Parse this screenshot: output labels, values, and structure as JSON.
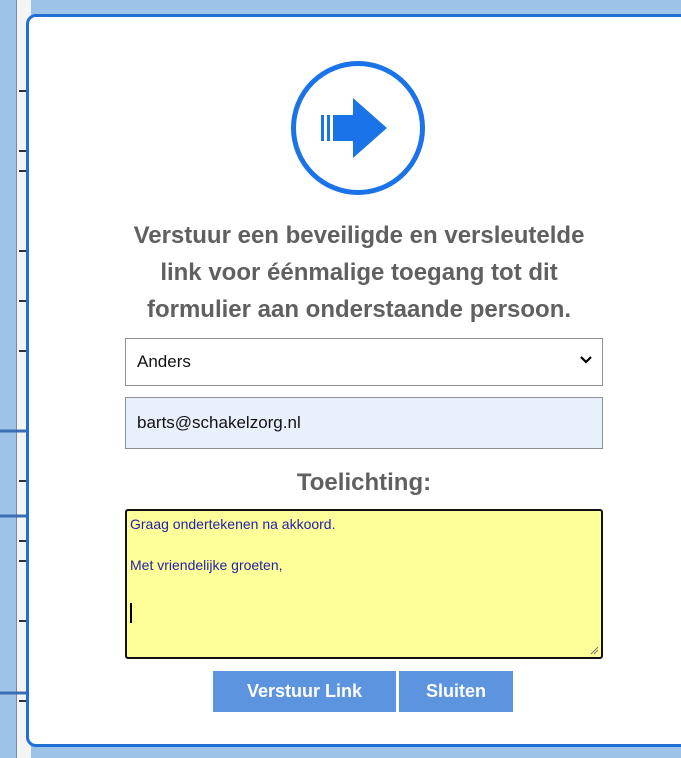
{
  "dialog": {
    "icon": "arrow-right-circle-icon",
    "title_lines": [
      "Verstuur een beveiligde en versleutelde",
      "link voor éénmalige toegang tot dit",
      "formulier aan onderstaande persoon."
    ],
    "recipient_select": {
      "selected": "Anders"
    },
    "email_field": {
      "value": "barts@schakelzorg.nl"
    },
    "toelichting_label": "Toelichting:",
    "toelichting_text": {
      "line1": "Graag ondertekenen na akkoord.",
      "line2": "Met vriendelijke groeten,"
    },
    "buttons": {
      "send": "Verstuur Link",
      "close": "Sluiten"
    }
  },
  "colors": {
    "accent": "#1a73e8",
    "button": "#5c94e0",
    "textarea_bg": "#ffff99",
    "email_bg": "#e8f0fe",
    "background": "#9ec3e8"
  }
}
